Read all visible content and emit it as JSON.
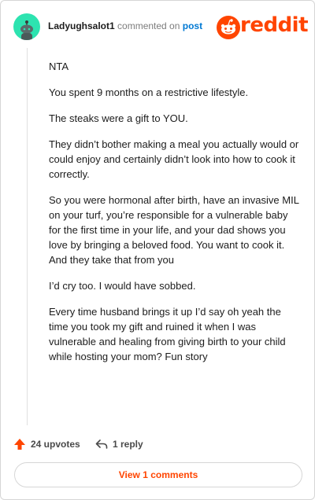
{
  "comment": {
    "username": "Ladyughsalot1",
    "action_text": "commented on",
    "post_link": "post",
    "paragraphs": [
      "NTA",
      "You spent 9 months on a restrictive lifestyle.",
      "The steaks were a gift to YOU.",
      "They didn’t bother making a meal you actually would or could enjoy and certainly didn’t look into how to cook it correctly.",
      "So you were hormonal after birth, have an invasive MIL on your turf, you’re responsible for a vulnerable baby for the first time in your life, and your dad shows you love by bringing a beloved food. You want to cook it. And they take that from you",
      "I’d cry too. I would have sobbed.",
      "Every time husband brings it up I’d say oh yeah the time you took my gift and ruined it when I was vulnerable and healing from giving birth to your child while hosting your mom? Fun story"
    ]
  },
  "logo": {
    "wordmark": "reddit",
    "icon": "reddit-snoo-icon"
  },
  "actions": {
    "upvotes_label": "24 upvotes",
    "upvote_icon": "upvote-arrow-icon",
    "reply_label": "1 reply",
    "reply_icon": "reply-arrow-icon"
  },
  "view_button": {
    "label": "View 1 comments"
  },
  "colors": {
    "brand": "#ff4500",
    "avatar": "#2de3b0",
    "link": "#0079d3"
  }
}
